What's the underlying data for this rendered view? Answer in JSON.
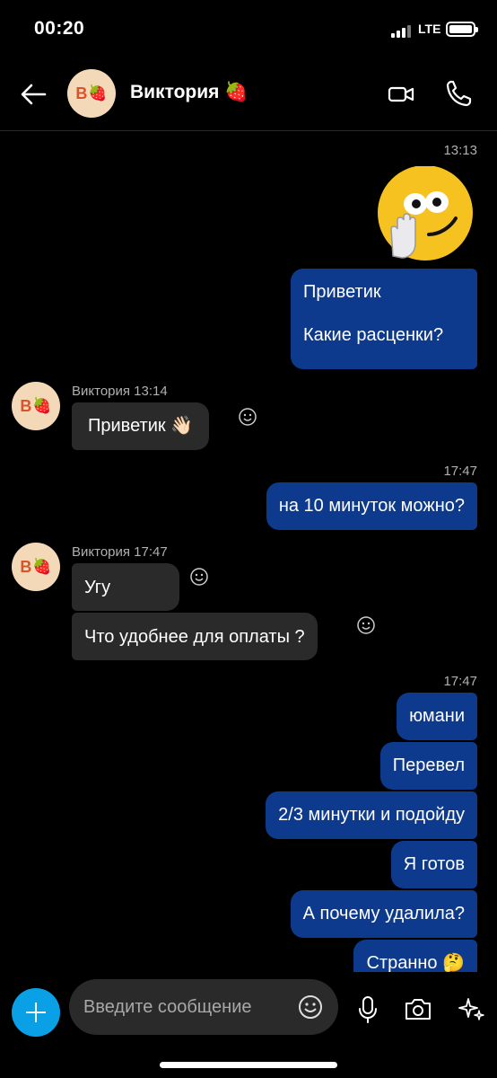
{
  "status": {
    "time": "00:20",
    "network": "LTE"
  },
  "header": {
    "name": "Виктория 🍓",
    "avatar_letter": "В",
    "avatar_emoji": "🍓"
  },
  "messages": {
    "t1": "13:13",
    "sticker": "face-with-hand-sticker",
    "m1_line1": "Приветик",
    "m1_line2": "Какие расценки?",
    "s1": "Виктория 13:14",
    "m2": "Приветик 👋🏻",
    "t2": "17:47",
    "m3": "на 10 минуток можно?",
    "s2": "Виктория 17:47",
    "m4": "Угу",
    "m5": "Что удобнее для оплаты ?",
    "t3": "17:47",
    "m6": "юмани",
    "m7": "Перевел",
    "m8": "2/3 минутки и подойду",
    "m9": "Я готов",
    "m10": "А почему удалила?",
    "m11": "Странно 🤔"
  },
  "compose": {
    "placeholder": "Введите сообщение"
  },
  "colors": {
    "outgoing": "#0d3a8c",
    "incoming": "#2a2a2a",
    "accent": "#0aa0e6"
  }
}
